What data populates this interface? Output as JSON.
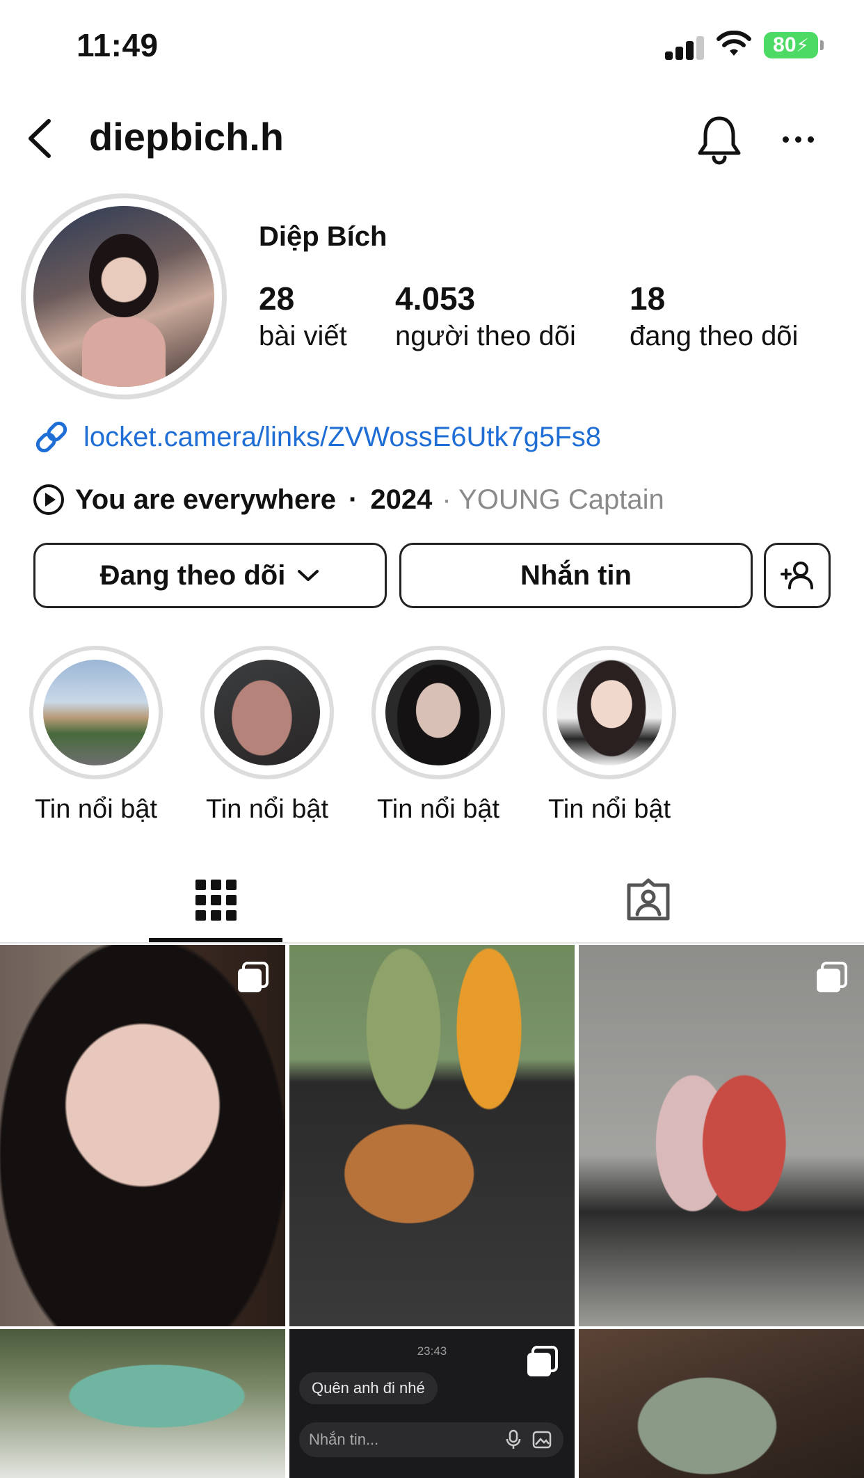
{
  "status_bar": {
    "time": "11:49",
    "battery": "80"
  },
  "header": {
    "username": "diepbich.h"
  },
  "profile": {
    "display_name": "Diệp Bích",
    "stats": [
      {
        "value": "28",
        "label": "bài viết"
      },
      {
        "value": "4.053",
        "label": "người theo dõi"
      },
      {
        "value": "18",
        "label": "đang theo dõi"
      }
    ],
    "link": "locket.camera/links/ZVWossE6Utk7g5Fs8",
    "music": {
      "title": "You are everywhere",
      "separator": "·",
      "year": "2024",
      "artist": "· YOUNG Captain"
    }
  },
  "actions": {
    "following_label": "Đang theo dõi",
    "message_label": "Nhắn tin"
  },
  "highlights": [
    {
      "label": "Tin nổi bật"
    },
    {
      "label": "Tin nổi bật"
    },
    {
      "label": "Tin nổi bật"
    },
    {
      "label": "Tin nổi bật"
    }
  ],
  "tabs": {
    "active": "posts-grid"
  },
  "posts": {
    "chat_preview": {
      "time": "23:43",
      "bubble": "Quên anh đi nhé",
      "input_placeholder": "Nhắn tin..."
    }
  },
  "colors": {
    "link": "#1f6ed6",
    "battery": "#4cd964",
    "secondary_text": "#8a8a8a"
  }
}
